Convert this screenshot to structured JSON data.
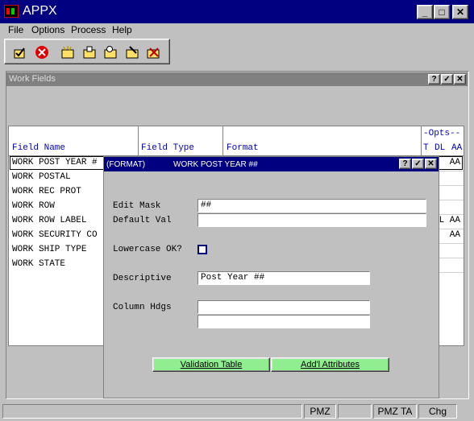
{
  "window": {
    "title": "APPX"
  },
  "menu": {
    "items": [
      "File",
      "Options",
      "Process",
      "Help"
    ]
  },
  "toolbar": {
    "icons": [
      "select-icon",
      "cancel-icon",
      "new-icon",
      "open-icon",
      "search-icon",
      "edit-icon",
      "delete-icon"
    ]
  },
  "panel": {
    "title": "Work Fields"
  },
  "grid": {
    "headers": {
      "field_name": "Field Name",
      "field_type": "Field Type",
      "format": "Format",
      "opts": "-Opts--",
      "t": "T",
      "dl": "DL",
      "aa": "AA"
    },
    "rows": [
      {
        "name": "WORK POST YEAR #",
        "opts": "AA"
      },
      {
        "name": "WORK POSTAL",
        "opts": ""
      },
      {
        "name": "WORK REC PROT",
        "opts": ""
      },
      {
        "name": "WORK ROW",
        "opts": ""
      },
      {
        "name": "WORK ROW LABEL",
        "opts": "L AA"
      },
      {
        "name": "WORK SECURITY CO",
        "opts": "AA"
      },
      {
        "name": "WORK SHIP TYPE",
        "opts": ""
      },
      {
        "name": "WORK STATE",
        "opts": ""
      }
    ]
  },
  "dialog": {
    "tag": "(FORMAT)",
    "title": "WORK POST YEAR ##",
    "edit_mask_label": "Edit Mask",
    "edit_mask_value": "##",
    "default_val_label": "Default Val",
    "default_val_value": "",
    "lowercase_label": "Lowercase OK?",
    "descriptive_label": "Descriptive",
    "descriptive_value": "Post Year ##",
    "column_hdgs_label": "Column Hdgs",
    "column_hdg1": "",
    "column_hdg2": "",
    "validation_button": "Validation Table",
    "attributes_button": "Add'l Attributes"
  },
  "status": {
    "pmz": "PMZ",
    "pmzta": "PMZ TA",
    "chg": "Chg"
  },
  "colors": {
    "titlebar": "#000080",
    "button_green": "#90ee90",
    "header_text": "#0000c0"
  }
}
